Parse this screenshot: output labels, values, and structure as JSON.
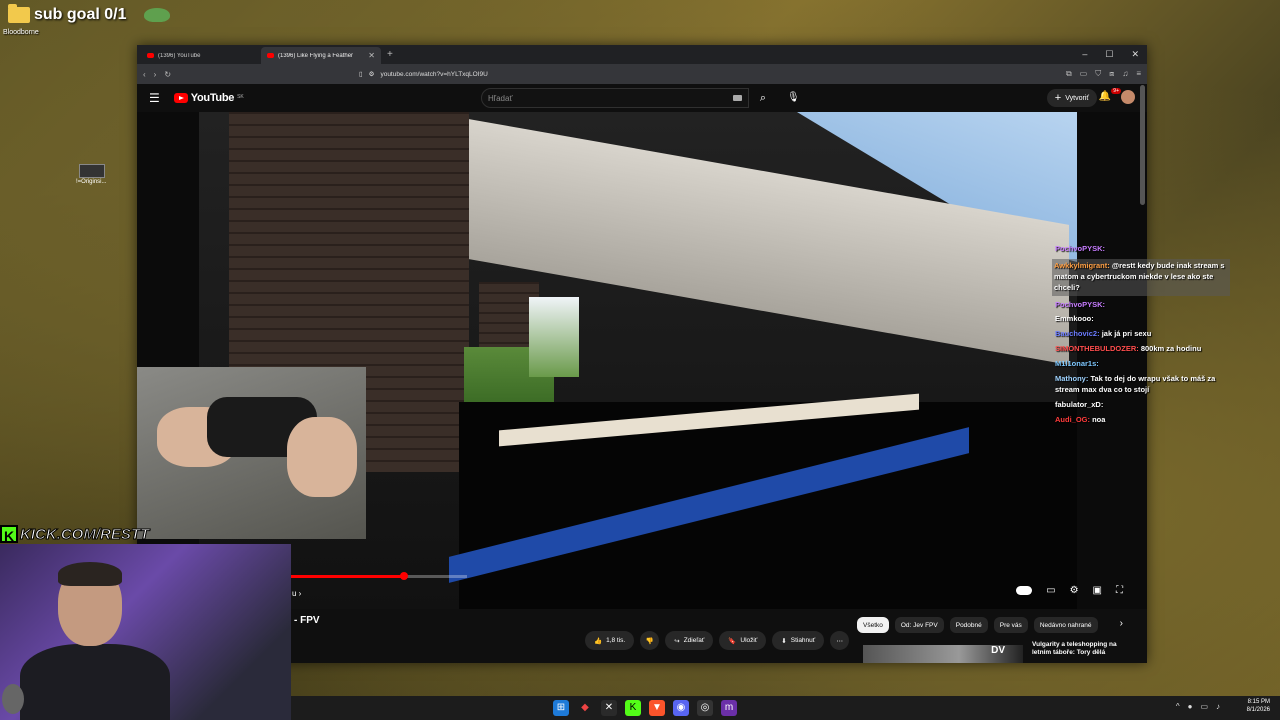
{
  "overlay": {
    "sub_goal": "sub goal 0/1",
    "desktop_label": "Bloodborne",
    "desktop_icon2_label": "!=Originsi..."
  },
  "browser": {
    "tabs": [
      {
        "title": "(1396) YouTube",
        "active": false
      },
      {
        "title": "(1396) Like Flying a Feather",
        "active": true
      }
    ],
    "new_tab": "+",
    "window_controls": [
      "–",
      "☐",
      "✕"
    ],
    "url": "youtube.com/watch?v=hYLTxqLOI9U"
  },
  "youtube": {
    "logo": "YouTube",
    "country": "SK",
    "search_placeholder": "Hľadať",
    "create_label": "Vytvoriť",
    "notif_badge": "9+",
    "video_title": "- FPV",
    "title_arrow": "u ›",
    "progress_fraction": 0.64,
    "actions": [
      {
        "icon": "👍",
        "label": "1,8 tis."
      },
      {
        "icon": "👎",
        "label": ""
      },
      {
        "icon": "↪",
        "label": "Zdieľať"
      },
      {
        "icon": "🔖",
        "label": "Uložiť"
      },
      {
        "icon": "⬇",
        "label": "Stiahnuť"
      },
      {
        "icon": "⋯",
        "label": ""
      }
    ],
    "chips": [
      {
        "label": "Všetko",
        "active": true
      },
      {
        "label": "Od: Jev FPV",
        "active": false
      },
      {
        "label": "Podobné",
        "active": false
      },
      {
        "label": "Pre vás",
        "active": false
      },
      {
        "label": "Nedávno nahrané",
        "active": false
      }
    ],
    "recommended_title": "Vulgarity a teleshopping na letním táboře: Tory dělá",
    "recommended_badge": "DV"
  },
  "chat": [
    {
      "user": "PochvoPYSK:",
      "color": "#c77dff",
      "text": "",
      "highlight": false
    },
    {
      "user": "Awkkylmigrant:",
      "color": "#ff9f43",
      "text": "@restt kedy bude inak stream s matom a cybertruckom niekde v lese ako ste chceli?",
      "highlight": true
    },
    {
      "user": "PochvoPYSK:",
      "color": "#c77dff",
      "text": "",
      "highlight": false
    },
    {
      "user": "",
      "color": "#ffffff",
      "text": "Emmkooo:",
      "highlight": false
    },
    {
      "user": "Bauchovic2:",
      "color": "#6b7cff",
      "text": "jak já pri sexu",
      "highlight": false
    },
    {
      "user": "SIMONTHEBULDOZER:",
      "color": "#ff4d4d",
      "text": "800km za hodinu",
      "highlight": false
    },
    {
      "user": "M1l1onar1s:",
      "color": "#7ec8ff",
      "text": "",
      "highlight": false
    },
    {
      "user": "Mathony:",
      "color": "#9fd3ff",
      "text": "Tak to dej do wrapu však to máš za stream max dva co to stojí",
      "highlight": false
    },
    {
      "user": "fabulator_xD:",
      "color": "#ffffff",
      "text": "",
      "highlight": false
    },
    {
      "user": "Audi_OG:",
      "color": "#ff3b3b",
      "text": "noa",
      "highlight": false
    }
  ],
  "webcam": {
    "kick_text": "KICK.COM/RESTT"
  },
  "taskbar": {
    "time": "8:15 PM",
    "date": "8/1/2026"
  },
  "colors": {
    "yt_red": "#ff0000",
    "kick_green": "#53fc18"
  }
}
